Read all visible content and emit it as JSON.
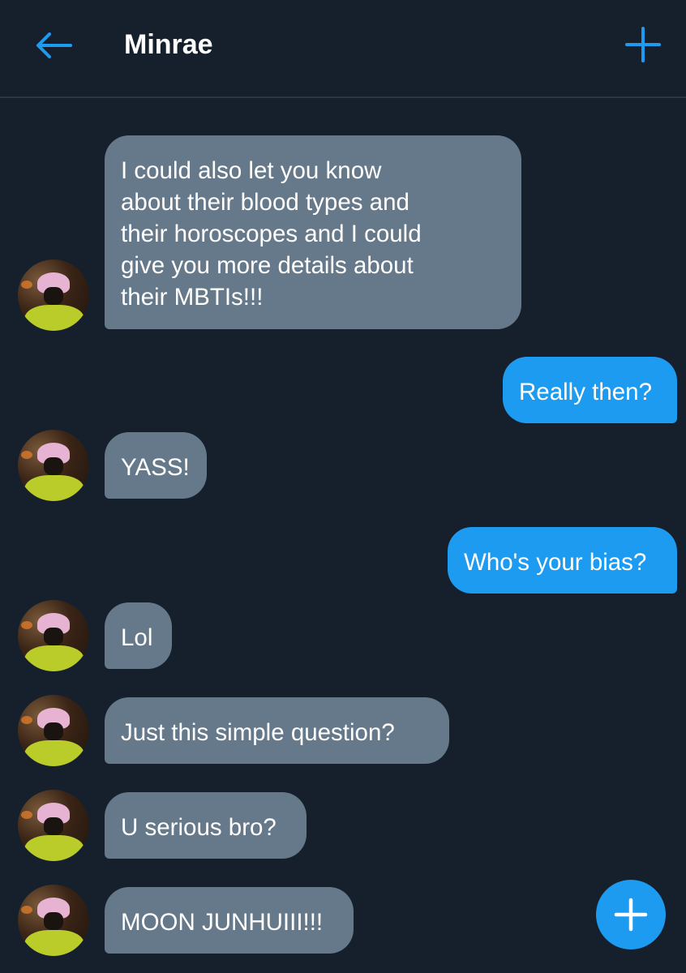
{
  "header": {
    "title": "Minrae",
    "back_icon": "arrow-left-icon",
    "new_icon": "plus-icon"
  },
  "colors": {
    "background": "#16202c",
    "accent": "#1d9bf0",
    "incoming_bubble": "#66798a",
    "divider": "#2a3642"
  },
  "messages": [
    {
      "direction": "incoming",
      "text": "I could also let you know\nabout their blood types and\ntheir horoscopes and I could\ngive you more details about\ntheir MBTIs!!!"
    },
    {
      "direction": "outgoing",
      "text": "Really then?"
    },
    {
      "direction": "incoming",
      "text": "YASS!"
    },
    {
      "direction": "outgoing",
      "text": "Who's your bias?"
    },
    {
      "direction": "incoming",
      "text": "Lol"
    },
    {
      "direction": "incoming",
      "text": "Just this simple question?"
    },
    {
      "direction": "incoming",
      "text": "U serious bro?"
    },
    {
      "direction": "incoming",
      "text": "MOON JUNHUIII!!!"
    }
  ],
  "fab": {
    "icon": "plus-icon"
  }
}
